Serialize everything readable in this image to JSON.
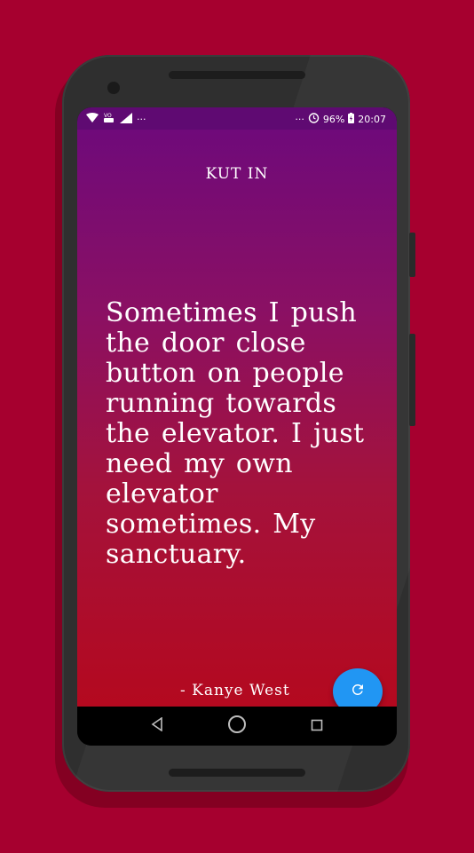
{
  "status_bar": {
    "time": "20:07",
    "battery": "96%",
    "more_left": "···",
    "more_right": "···"
  },
  "app": {
    "title": "KUT IN"
  },
  "quote": {
    "text": "Sometimes I push the door close button on people running towards the elevator. I just need my own elevator sometimes. My sanctuary.",
    "author": "- Kanye West"
  },
  "fab": {
    "icon": "refresh-icon",
    "color": "#2196f3"
  },
  "nav": {
    "back_icon": "back-triangle-icon",
    "home_icon": "home-circle-icon",
    "recents_icon": "recents-square-icon"
  },
  "colors": {
    "background": "#a6002f",
    "gradient_top": "#6f0a7a",
    "gradient_bottom": "#b4091f"
  }
}
